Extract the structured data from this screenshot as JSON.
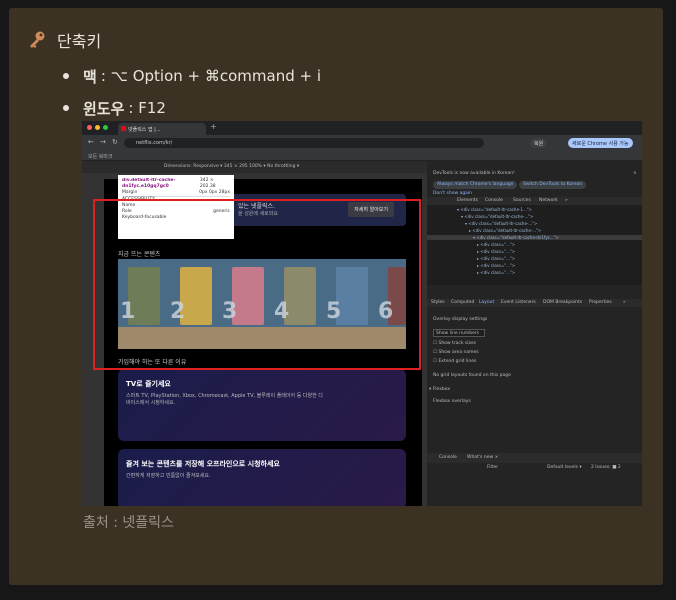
{
  "heading": {
    "icon": "key-icon",
    "title": "단축키"
  },
  "shortcuts": [
    {
      "label": "맥",
      "keys": ": ⌥ Option + ⌘command + i"
    },
    {
      "label": "윈도우",
      "keys": ": F12"
    }
  ],
  "caption": "출처 : 넷플릭스",
  "screenshot": {
    "tab_title": "넷플릭스 앱 |...",
    "url": "netflix.com/kr/",
    "chip_restore": "복원",
    "chip_update": "새로운 Chrome 사용 가능",
    "bookmarks": "모든 북마크",
    "device_toolbar": "Dimensions: Responsive ▾   345  ×  295   100% ▾   No throttling ▾",
    "tooltip": {
      "selector": "div.default-ltr-cache-dn1fyc.e10gq7gc0",
      "size": "342 × 202.38",
      "row1_label": "Margin",
      "row1_value": "0px 0px 28px",
      "section": "ACCESSIBILITY",
      "row2_label": "Name",
      "row3_label": "Role",
      "row3_value": "generic",
      "row4_label": "Keyboard-focusable"
    },
    "banner_text": "있는 넷플릭스.",
    "banner_sub": "을 성원에 새로와요",
    "banner_button": "자세히 알아보기",
    "trend_title": "지금 뜨는 콘텐츠",
    "ranks": [
      "1",
      "2",
      "3",
      "4",
      "5",
      "6"
    ],
    "reason_title": "가입해야 하는 또 다른 이유",
    "card1_title": "TV로 즐기세요",
    "card1_desc": "스마트 TV, PlayStation, Xbox, Chromecast, Apple TV, 블루레이 플레이어 등 다양한 디바이스에서 시청하세요.",
    "card2_title": "즐겨 보는 콘텐츠를 저장해 오프라인으로 시청하세요",
    "card2_desc": "간편하게 저장하고 빈틈없이 즐겨보세요.",
    "devtools": {
      "notice": "DevTools is now available in Korean!",
      "btn_match": "Always match Chrome's language",
      "btn_switch": "Switch DevTools to Korean",
      "dont_show": "Don't show again",
      "tabs": [
        "Elements",
        "Console",
        "Sources",
        "Network",
        "»"
      ],
      "sub_tabs": [
        "Styles",
        "Computed",
        "Layout",
        "Event Listeners",
        "DOM Breakpoints",
        "Properties",
        "»"
      ],
      "overlay_title": "Overlay display settings",
      "line_numbers": "Show line numbers",
      "opt1": "Show track sizes",
      "opt2": "Show area names",
      "opt3": "Extend grid lines",
      "flexbox_head": "▾ Flexbox",
      "flexbox": "Flexbox overlays",
      "grid_none": "No grid layouts found on this page",
      "console": "Console",
      "whats_new": "What's new ×",
      "filter": "Filter",
      "levels": "Default levels ▾",
      "issues": "2 Issues: ■ 2"
    }
  }
}
